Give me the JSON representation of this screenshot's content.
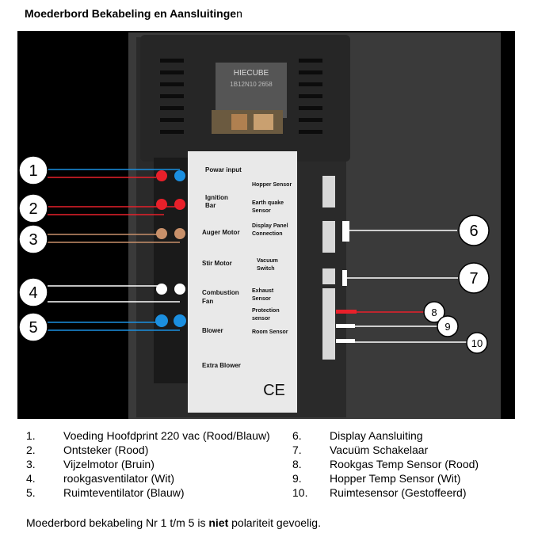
{
  "title": {
    "main": "Moederbord Bekabeling en Aansluitinge",
    "tail": "n"
  },
  "board": {
    "logo": "HIECUBE",
    "model": "1B12N10 2658",
    "left_labels": [
      "Powar input",
      "Ignition",
      "Bar",
      "Auger Motor",
      "Stir Motor",
      "Combustion",
      "Fan",
      "Blower",
      "Extra Blower"
    ],
    "right_labels": [
      "Hopper Sensor",
      "Earth quake",
      "Sensor",
      "Display Panel",
      "Connection",
      "Vacuum",
      "Switch",
      "Exhaust",
      "Sensor",
      "Protection",
      "sensor",
      "Room Sensor"
    ],
    "ce_mark": "CE"
  },
  "callouts": [
    "1",
    "2",
    "3",
    "4",
    "5",
    "6",
    "7",
    "8",
    "9",
    "10"
  ],
  "legend_left": [
    {
      "num": "1.",
      "text": "Voeding Hoofdprint 220 vac (Rood/Blauw)"
    },
    {
      "num": "2.",
      "text": "Ontsteker (Rood)"
    },
    {
      "num": "3.",
      "text": "Vijzelmotor (Bruin)"
    },
    {
      "num": "4.",
      "text": "rookgasventilator (Wit)"
    },
    {
      "num": "5.",
      "text": "Ruimteventilator (Blauw)"
    }
  ],
  "legend_right": [
    {
      "num": "6.",
      "text": "Display Aansluiting"
    },
    {
      "num": "7.",
      "text": "Vacuüm Schakelaar"
    },
    {
      "num": "8.",
      "text": "Rookgas Temp Sensor (Rood)"
    },
    {
      "num": "9.",
      "text": "Hopper Temp Sensor (Wit)"
    },
    {
      "num": "10.",
      "text": "Ruimtesensor (Gestoffeerd)"
    }
  ],
  "note": {
    "before": "Moederbord bekabeling Nr 1 t/m 5 is ",
    "bold": "niet",
    "after": " polariteit gevoelig."
  },
  "colors": {
    "red": "#e8202a",
    "blue": "#1b8fe0",
    "brown": "#c8906a",
    "white": "#ffffff",
    "black": "#000000"
  }
}
